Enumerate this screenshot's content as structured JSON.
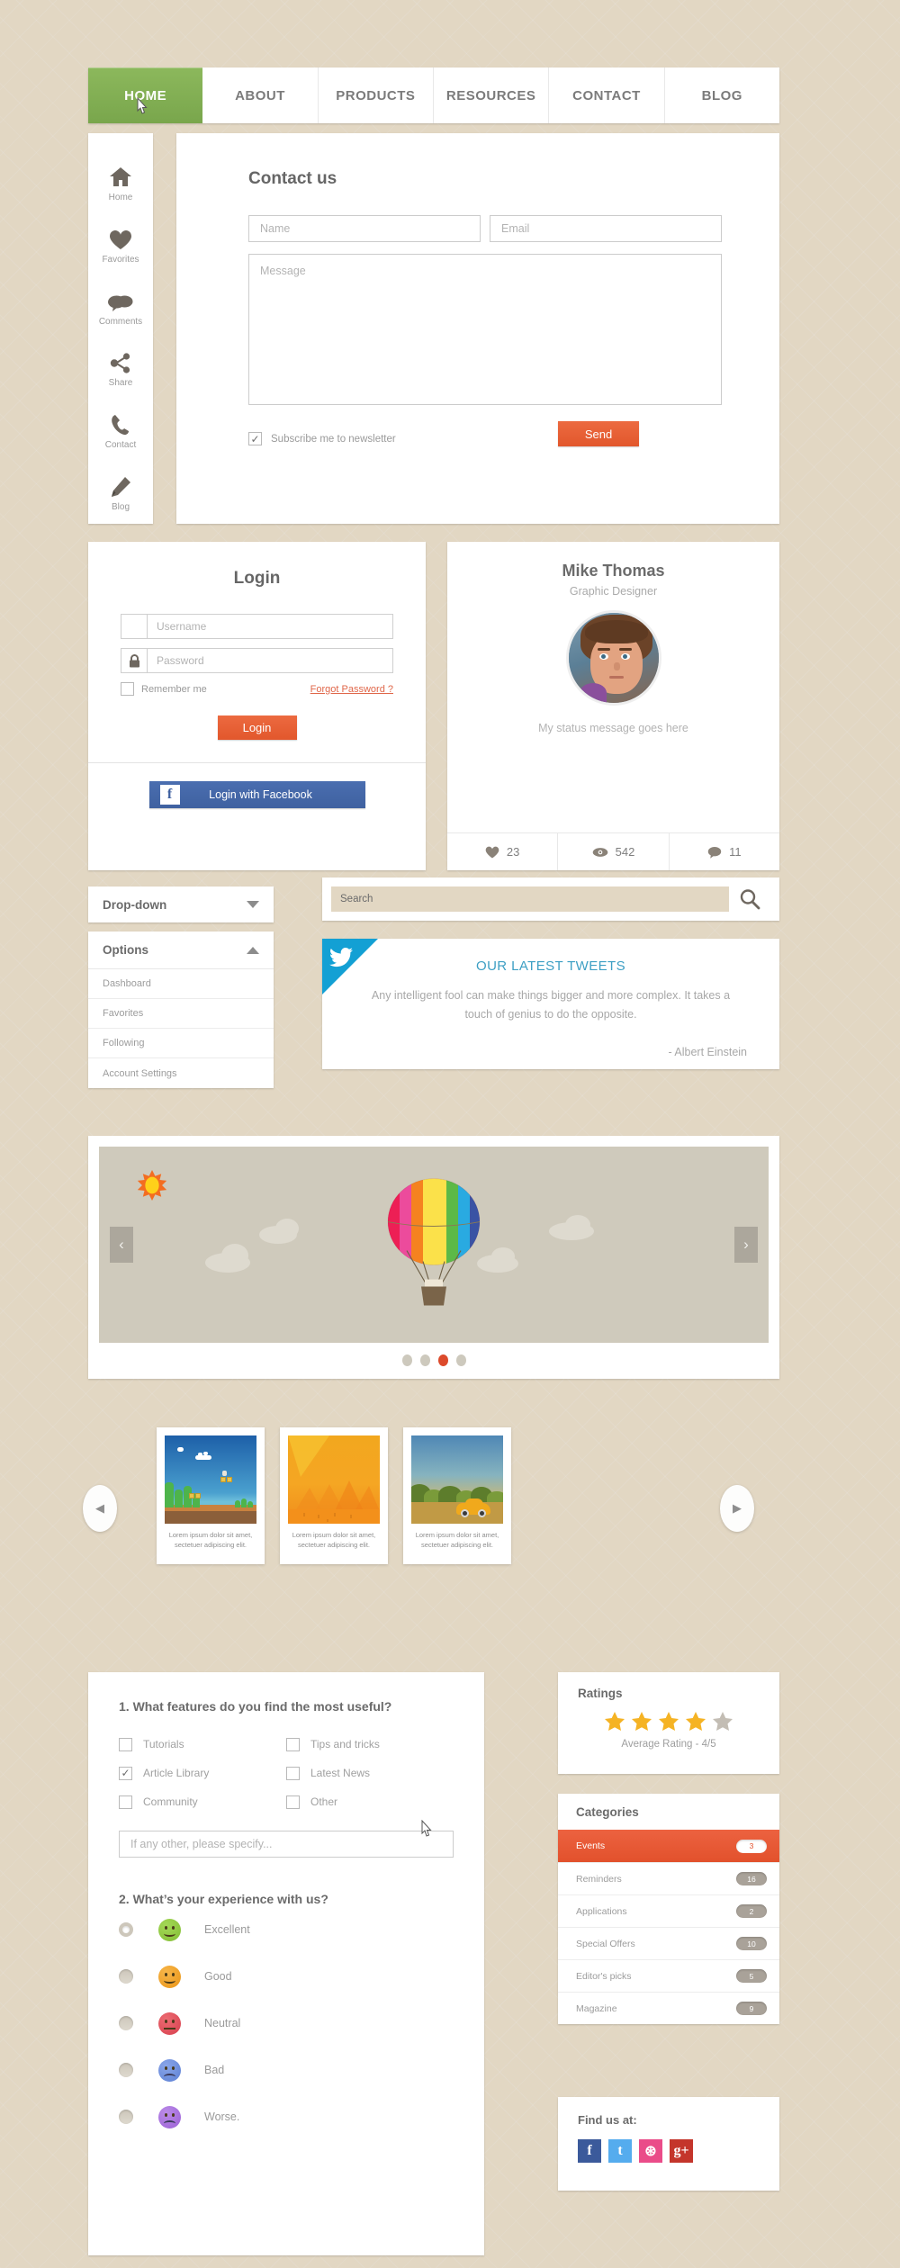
{
  "nav": {
    "items": [
      {
        "label": "HOME",
        "active": true
      },
      {
        "label": "ABOUT",
        "active": false
      },
      {
        "label": "PRODUCTS",
        "active": false
      },
      {
        "label": "RESOURCES",
        "active": false
      },
      {
        "label": "CONTACT",
        "active": false
      },
      {
        "label": "BLOG",
        "active": false
      }
    ]
  },
  "rail": {
    "items": [
      {
        "label": "Home",
        "icon": "home-icon"
      },
      {
        "label": "Favorites",
        "icon": "heart-icon"
      },
      {
        "label": "Comments",
        "icon": "comments-icon"
      },
      {
        "label": "Share",
        "icon": "share-icon"
      },
      {
        "label": "Contact",
        "icon": "phone-icon"
      },
      {
        "label": "Blog",
        "icon": "pencil-icon"
      }
    ]
  },
  "contact": {
    "title": "Contact us",
    "name_placeholder": "Name",
    "email_placeholder": "Email",
    "message_placeholder": "Message",
    "subscribe_label": "Subscribe me to newsletter",
    "subscribe_checked": true,
    "send_label": "Send"
  },
  "login": {
    "title": "Login",
    "username_placeholder": "Username",
    "password_placeholder": "Password",
    "remember_label": "Remember me",
    "remember_checked": false,
    "forgot_label": "Forgot Password ?",
    "login_label": "Login",
    "facebook_label": "Login with Facebook"
  },
  "profile": {
    "name": "Mike Thomas",
    "role": "Graphic Designer",
    "status": "My status message goes here",
    "stats": [
      {
        "icon": "heart-icon",
        "value": "23"
      },
      {
        "icon": "eye-icon",
        "value": "542"
      },
      {
        "icon": "comment-icon",
        "value": "11"
      }
    ]
  },
  "dropdown": {
    "label": "Drop-down"
  },
  "options": {
    "title": "Options",
    "items": [
      {
        "label": "Dashboard"
      },
      {
        "label": "Favorites"
      },
      {
        "label": "Following"
      },
      {
        "label": "Account Settings"
      }
    ]
  },
  "search": {
    "value": "Search",
    "placeholder": "Search"
  },
  "tweets": {
    "title": "OUR LATEST TWEETS",
    "body": "Any intelligent fool can make things bigger and more complex. It takes a touch of genius to do the opposite.",
    "author": "- Albert Einstein"
  },
  "slider": {
    "prev": "‹",
    "next": "›",
    "dots": [
      {
        "active": false
      },
      {
        "active": false
      },
      {
        "active": true
      },
      {
        "active": false
      }
    ]
  },
  "gallery": {
    "prev": "◀",
    "next": "▶",
    "items": [
      {
        "caption": "Lorem ipsum dolor sit amet, sectetuer adipiscing elit."
      },
      {
        "caption": "Lorem ipsum dolor sit amet, sectetuer adipiscing elit."
      },
      {
        "caption": "Lorem ipsum dolor sit amet, sectetuer adipiscing elit."
      }
    ]
  },
  "survey": {
    "q1_title": "1. What features do you find the most useful?",
    "q1_left": [
      {
        "label": "Tutorials",
        "checked": false
      },
      {
        "label": "Article Library",
        "checked": true
      },
      {
        "label": "Community",
        "checked": false
      }
    ],
    "q1_right": [
      {
        "label": "Tips and tricks",
        "checked": false
      },
      {
        "label": "Latest News",
        "checked": false
      },
      {
        "label": "Other",
        "checked": false
      }
    ],
    "specify_placeholder": "If any other, please specify...",
    "q2_title": "2. What’s your experience with us?",
    "q2_options": [
      {
        "label": "Excellent",
        "color": "#8cc63e",
        "mood": "happy",
        "selected": true
      },
      {
        "label": "Good",
        "color": "#f0a024",
        "mood": "smile",
        "selected": false
      },
      {
        "label": "Neutral",
        "color": "#e0525c",
        "mood": "flat",
        "selected": false
      },
      {
        "label": "Bad",
        "color": "#6f8fdd",
        "mood": "sad",
        "selected": false
      },
      {
        "label": "Worse.",
        "color": "#a濃",
        "mood": "sad",
        "selected": false
      }
    ]
  },
  "ratings": {
    "title": "Ratings",
    "filled": 4,
    "total": 5,
    "average_text": "Average Rating - 4/5",
    "star_color": "#f5b324",
    "empty_color": "#c3bdb4"
  },
  "categories": {
    "title": "Categories",
    "items": [
      {
        "label": "Events",
        "count": "3",
        "active": true
      },
      {
        "label": "Reminders",
        "count": "16",
        "active": false
      },
      {
        "label": "Applications",
        "count": "2",
        "active": false
      },
      {
        "label": "Special Offers",
        "count": "10",
        "active": false
      },
      {
        "label": "Editor's picks",
        "count": "5",
        "active": false
      },
      {
        "label": "Magazine",
        "count": "9",
        "active": false
      }
    ]
  },
  "find_us": {
    "title": "Find us at:",
    "socials": [
      {
        "name": "facebook-icon",
        "glyph": "f"
      },
      {
        "name": "twitter-icon",
        "glyph": "t"
      },
      {
        "name": "dribbble-icon",
        "glyph": "⊛"
      },
      {
        "name": "googleplus-icon",
        "glyph": "g+"
      }
    ]
  },
  "colors": {
    "accent_orange": "#e2572c",
    "accent_green": "#79a64c",
    "twitter_blue": "#13a0d4",
    "background": "#e2d7c3"
  }
}
